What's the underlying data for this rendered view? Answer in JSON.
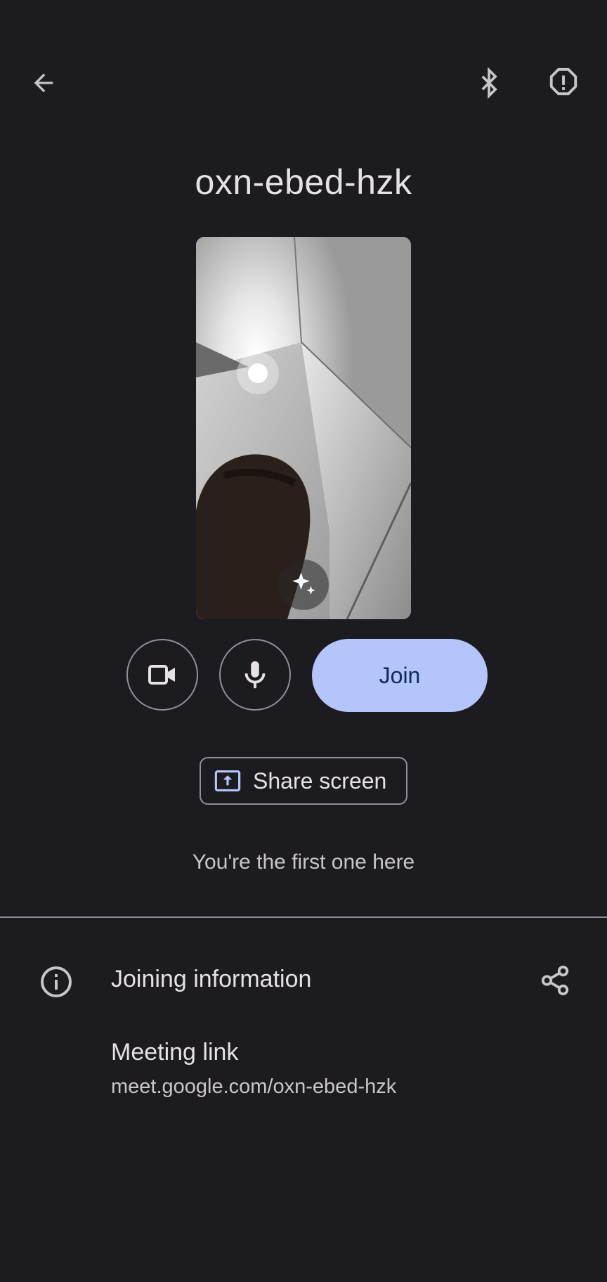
{
  "top_bar": {
    "back_icon": "arrow-back-icon",
    "bluetooth_icon": "bluetooth-icon",
    "report_icon": "report-icon"
  },
  "meeting": {
    "code": "oxn-ebed-hzk"
  },
  "preview": {
    "effects_icon": "sparkle-icon"
  },
  "controls": {
    "camera_icon": "videocam-icon",
    "mic_icon": "mic-icon",
    "join_label": "Join",
    "join_color": "#b3c5fa"
  },
  "share": {
    "label": "Share screen",
    "icon": "present-to-all-icon",
    "icon_color": "#b3c5fa"
  },
  "status": {
    "text": "You're the first one here"
  },
  "joining_info": {
    "title": "Joining information",
    "info_icon": "info-icon",
    "share_icon": "share-icon",
    "meeting_link_label": "Meeting link",
    "meeting_link_url": "meet.google.com/oxn-ebed-hzk"
  }
}
